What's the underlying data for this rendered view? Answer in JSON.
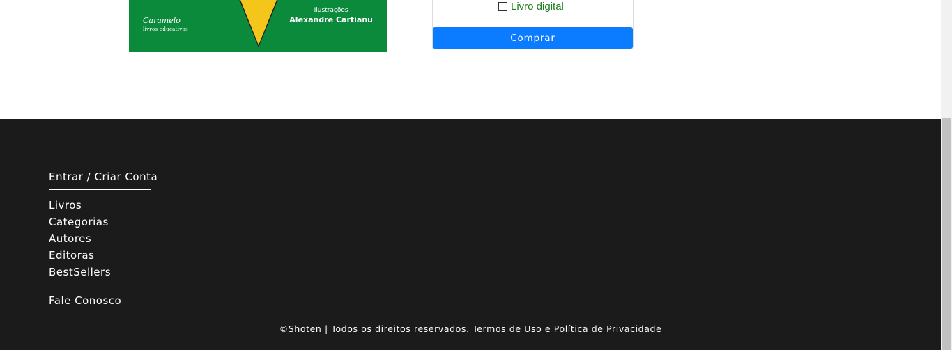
{
  "product": {
    "cover": {
      "publisher": "Caramelo",
      "publisher_tagline": "livros educativos",
      "illustrations_label": "Ilustrações",
      "illustrator": "Alexandre Cartianu"
    },
    "options": [
      {
        "label": "Livro digital",
        "checked": false
      }
    ],
    "buy_label": "Comprar"
  },
  "footer": {
    "account_link": "Entrar / Criar Conta",
    "nav": [
      "Livros",
      "Categorias",
      "Autores",
      "Editoras",
      "BestSellers"
    ],
    "contact_link": "Fale Conosco",
    "copyright": "©Shoten | Todos os direitos reservados. Termos de Uso e Política de Privacidade"
  },
  "colors": {
    "footer_bg": "#1b1b1b",
    "button_bg": "#0b7cff",
    "option_text": "#1e7d1e",
    "cover_green": "#0b8a3c",
    "cover_yellow": "#f4c51b"
  }
}
